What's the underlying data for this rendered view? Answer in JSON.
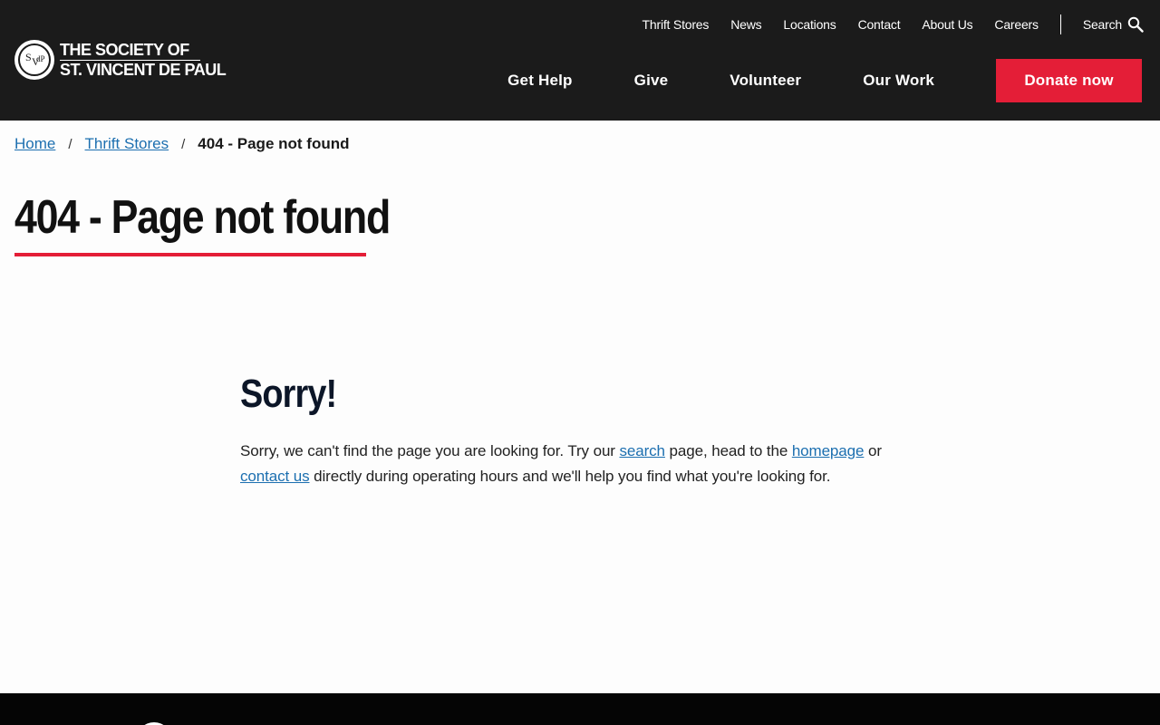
{
  "header": {
    "logo": {
      "line1": "The Society of",
      "line2": "St. Vincent de Paul"
    },
    "utility_nav": [
      "Thrift Stores",
      "News",
      "Locations",
      "Contact",
      "About Us",
      "Careers"
    ],
    "search_label": "Search",
    "main_nav": [
      "Get Help",
      "Give",
      "Volunteer",
      "Our Work"
    ],
    "donate_label": "Donate now"
  },
  "breadcrumb": {
    "home": "Home",
    "section": "Thrift Stores",
    "current": "404 - Page not found"
  },
  "page_title": "404 - Page not found",
  "content": {
    "heading": "Sorry!",
    "text_1": "Sorry, we can't find the page you are looking for. Try our ",
    "link_search": "search",
    "text_2": " page, head to the ",
    "link_homepage": "homepage",
    "text_3": " or ",
    "link_contact": "contact us",
    "text_4": " directly during operating hours and we'll help you find what you're looking for."
  },
  "colors": {
    "header_bg": "#1b1b1b",
    "accent_red": "#e41e37",
    "link_blue": "#1c6fb0",
    "footer_bg": "#050505"
  }
}
